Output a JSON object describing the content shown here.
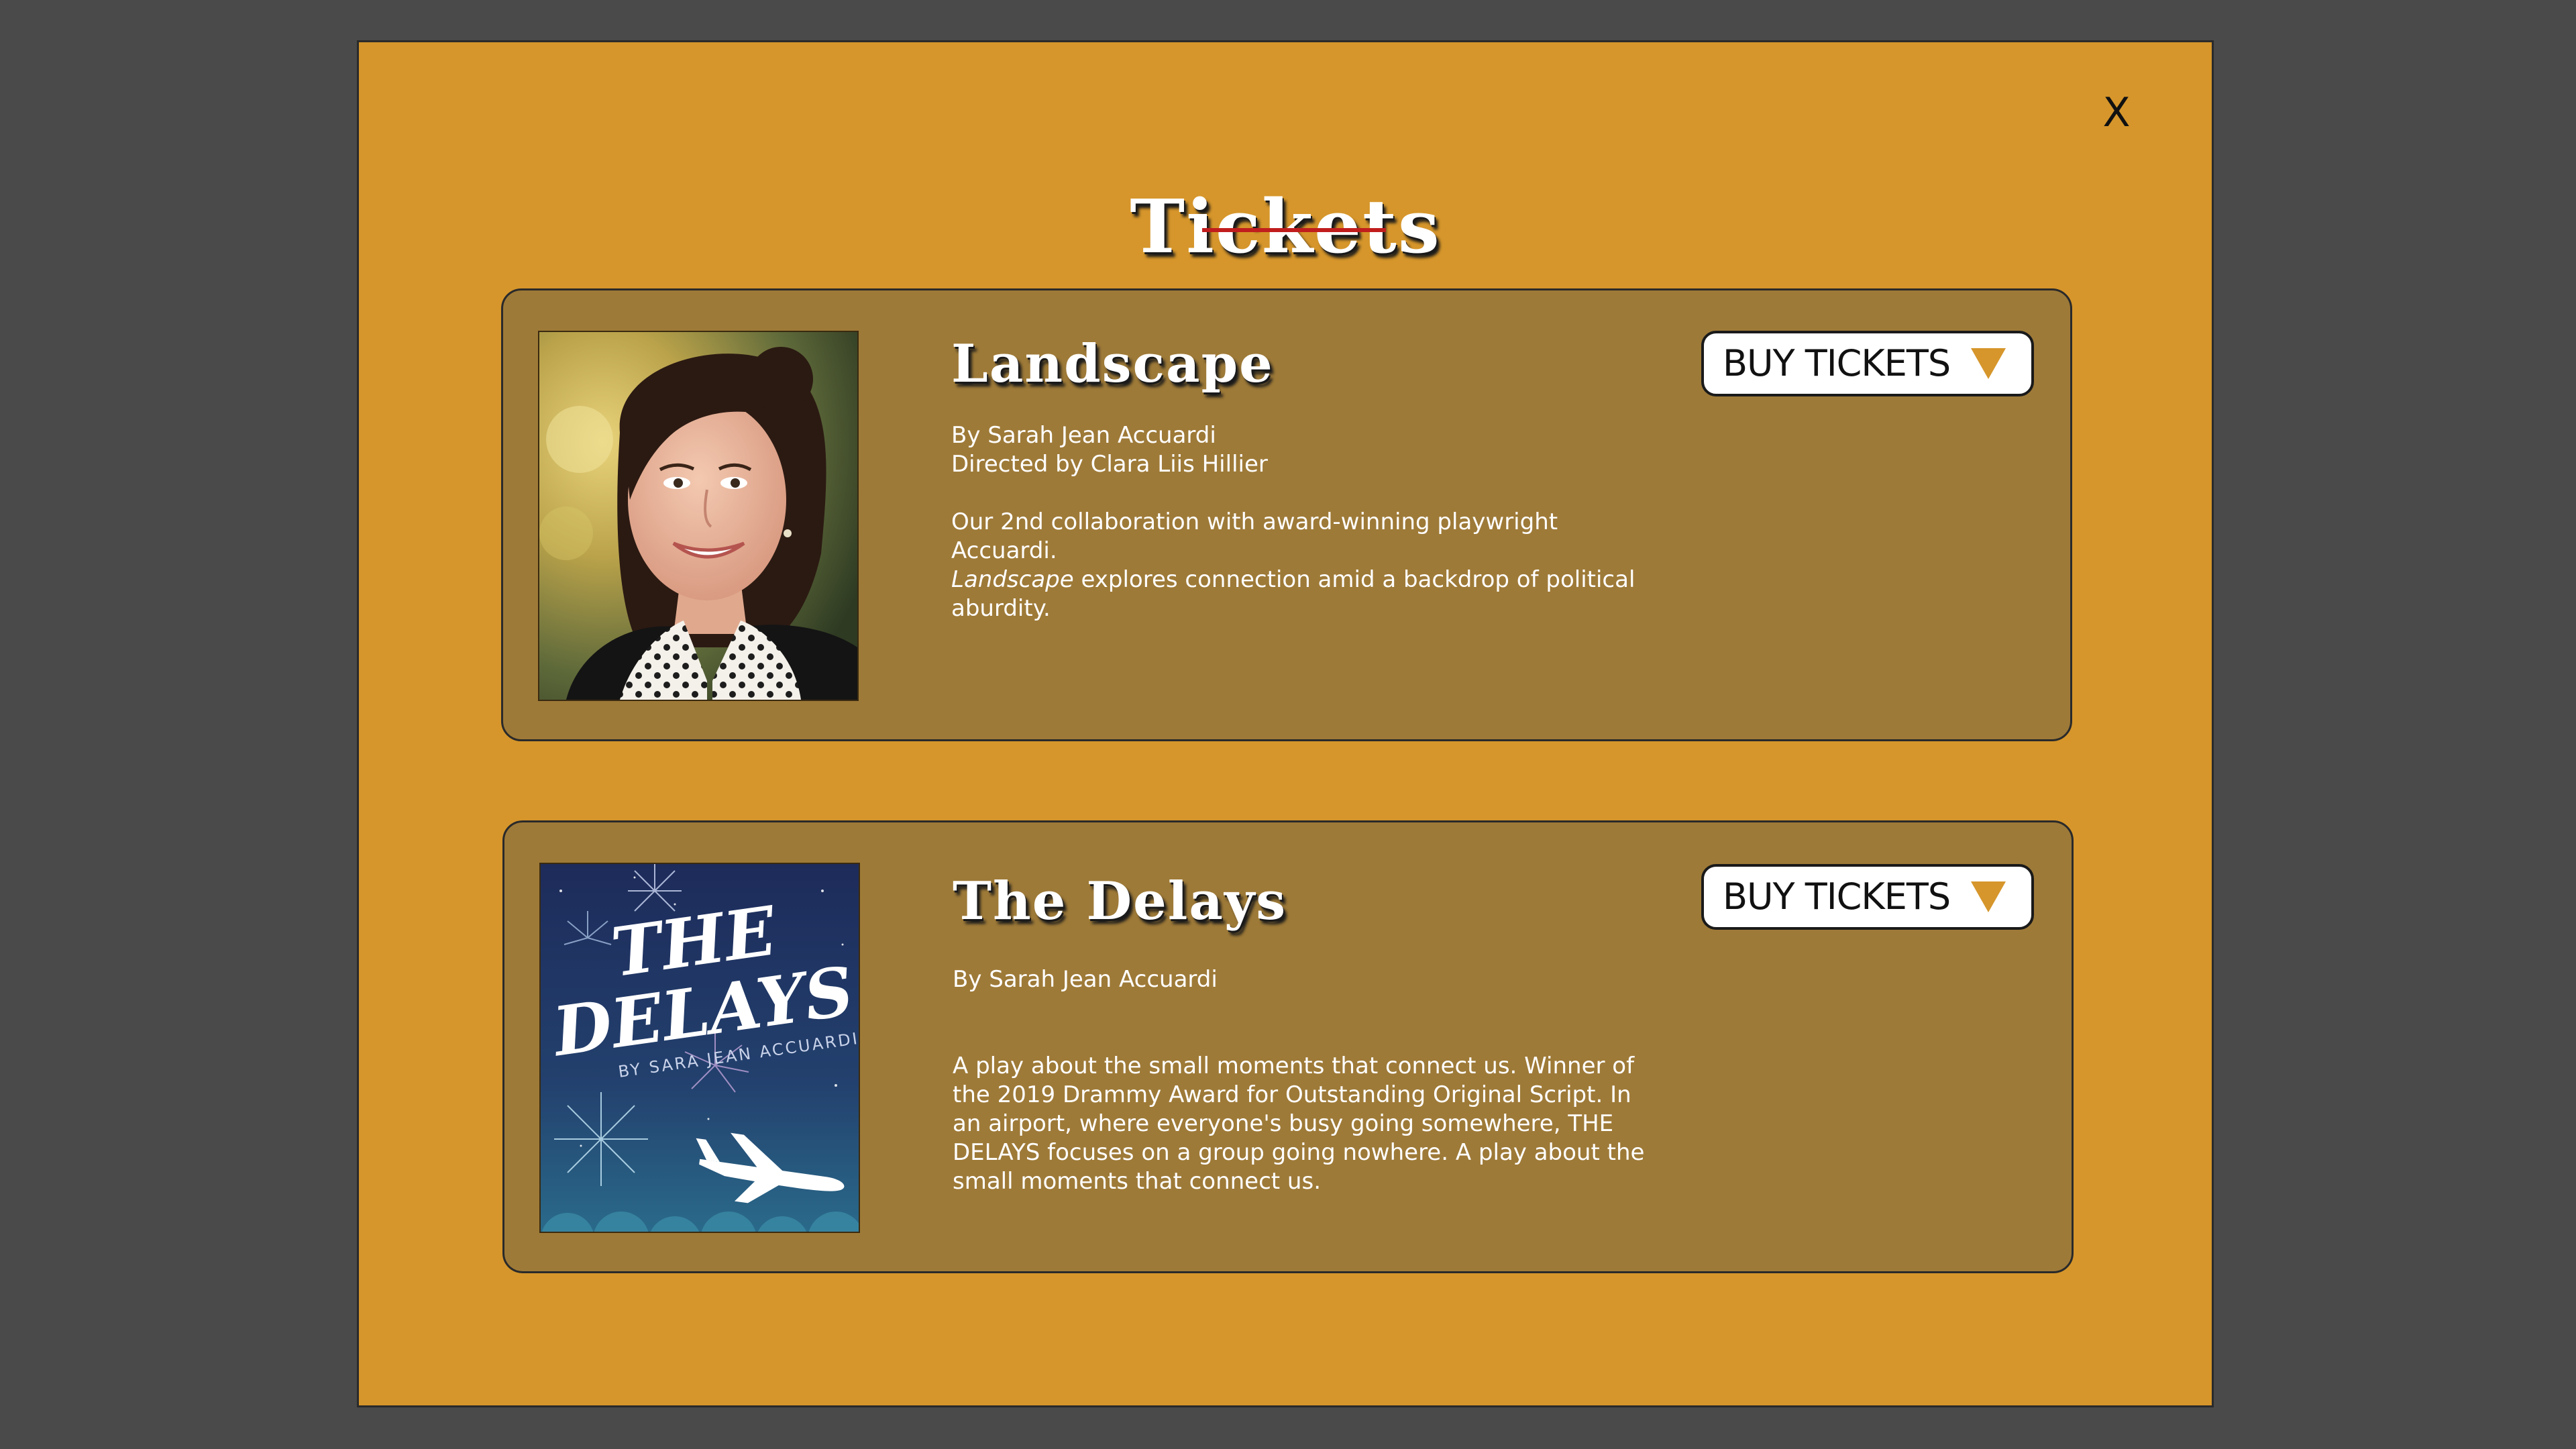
{
  "modal": {
    "close_label": "X",
    "title": "Tickets"
  },
  "shows": [
    {
      "title": "Landscape",
      "credit_line_1": "By Sarah Jean Accuardi",
      "credit_line_2": "Directed by Clara Liis Hillier",
      "description_line_1": "Our 2nd collaboration with award-winning playwright Accuardi.",
      "description_italic": "Landscape",
      "description_rest": " explores connection amid a backdrop of political abu rdity.",
      "buy_label": "BUY TICKETS",
      "poster_icon": "portrait-photo"
    },
    {
      "title": "The Delays",
      "credit_line_1": "By Sarah Jean Accuardi",
      "description": "A play about the small moments that connect us. Winner of the 2019 Drammy Award for Outstanding Original Script. In an airport, where everyone's busy going somewhere, THE DELAYS focuses on a group going nowhere. A play about the small moments that connect us.",
      "buy_label": "BUY TICKETS",
      "poster_title_line_1": "THE",
      "poster_title_line_2": "DELAYS",
      "poster_byline": "BY SARA JEAN ACCUARDI",
      "poster_icon": "airplane-fireworks-poster"
    }
  ],
  "colors": {
    "backdrop": "#4a4a4a",
    "modal_bg": "#d6962b",
    "card_bg": "#9e7a38",
    "underline": "#c11d1d",
    "caret": "#d6962b"
  }
}
